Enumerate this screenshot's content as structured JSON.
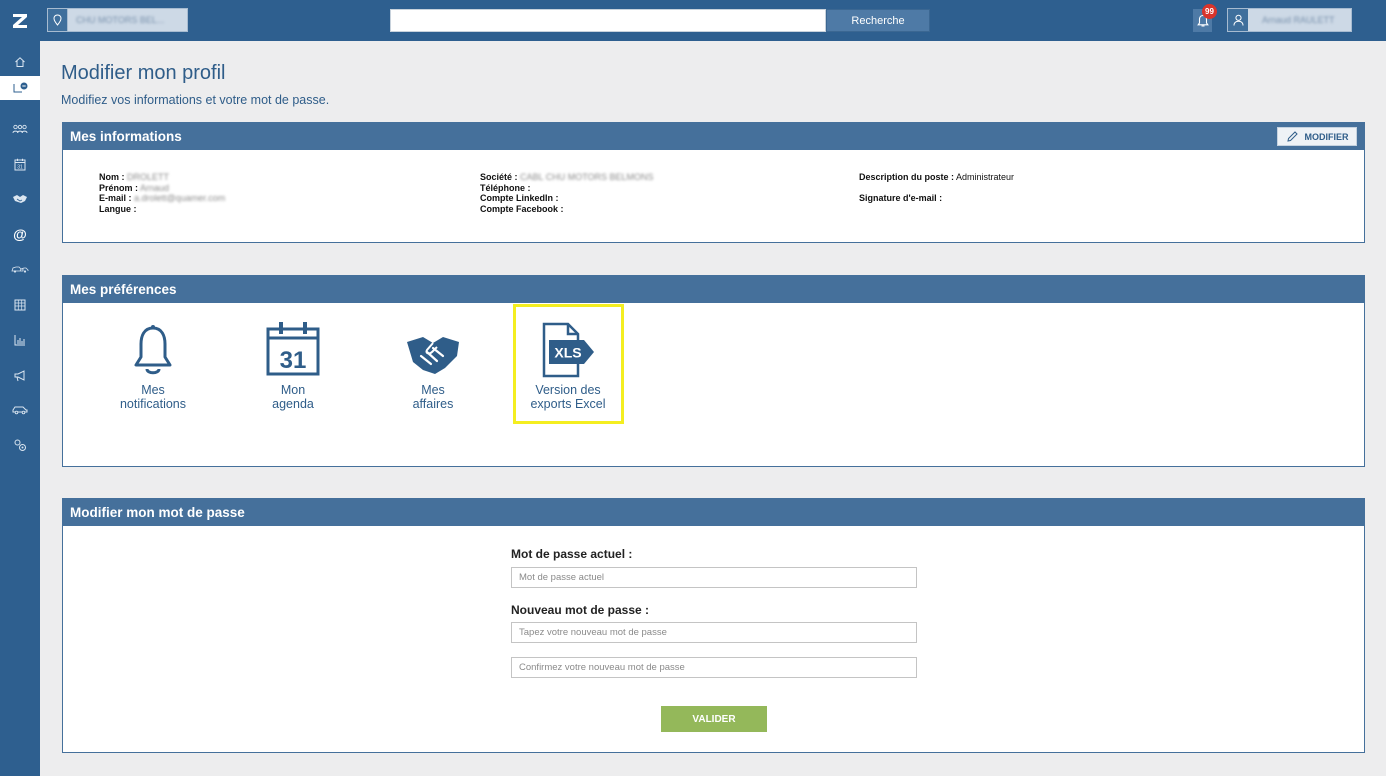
{
  "topbar": {
    "site_text": "CHU MOTORS BEL...",
    "search_button": "Recherche",
    "search_value": "",
    "notification_count": "99",
    "user_name": "Arnaud RAULETT"
  },
  "colors": {
    "brand": "#2e5f8f",
    "header": "#45709b",
    "accent_green": "#94b85a",
    "highlight": "#f4ee20",
    "badge": "#d9342b"
  },
  "sidebar": {
    "items": [
      {
        "icon": "home-icon"
      },
      {
        "icon": "task-list-icon"
      },
      {
        "icon": "contacts-icon"
      },
      {
        "icon": "calendar-icon"
      },
      {
        "icon": "handshake-icon"
      },
      {
        "icon": "at-icon"
      },
      {
        "icon": "vehicles-icon"
      },
      {
        "icon": "table-icon"
      },
      {
        "icon": "stats-icon"
      },
      {
        "icon": "megaphone-icon"
      },
      {
        "icon": "car-icon"
      },
      {
        "icon": "settings-icon"
      }
    ]
  },
  "header": {
    "title": "Modifier mon profil",
    "subtitle": "Modifiez vos informations et votre mot de passe."
  },
  "info": {
    "title": "Mes informations",
    "modify_label": "MODIFIER",
    "col1": [
      {
        "label": "Nom :",
        "value": "DROLETT"
      },
      {
        "label": "Prénom :",
        "value": "Arnaud"
      },
      {
        "label": "E-mail :",
        "value": "a.drolett@quamer.com"
      },
      {
        "label": "Langue :",
        "value": ""
      }
    ],
    "col2": [
      {
        "label": "Société :",
        "value": "CABL CHU MOTORS BELMONS"
      },
      {
        "label": "Téléphone :",
        "value": ""
      },
      {
        "label": "Compte LinkedIn :",
        "value": ""
      },
      {
        "label": "Compte Facebook :",
        "value": ""
      }
    ],
    "col3": [
      {
        "label": "Description du poste :",
        "value": "Administrateur"
      },
      {
        "label": "Signature d'e-mail :",
        "value": ""
      }
    ]
  },
  "preferences": {
    "title": "Mes préférences",
    "items": [
      {
        "line1": "Mes",
        "line2": "notifications",
        "icon": "bell-icon"
      },
      {
        "line1": "Mon",
        "line2": "agenda",
        "icon": "calendar-icon",
        "calendar_day": "31"
      },
      {
        "line1": "Mes",
        "line2": "affaires",
        "icon": "handshake-icon"
      },
      {
        "line1": "Version des",
        "line2": "exports Excel",
        "icon": "xls-file-icon",
        "file_label": "XLS"
      }
    ]
  },
  "password": {
    "title": "Modifier mon mot de passe",
    "current_label": "Mot de passe actuel :",
    "current_placeholder": "Mot de passe actuel",
    "new_label": "Nouveau mot de passe :",
    "new_placeholder": "Tapez votre nouveau mot de passe",
    "confirm_placeholder": "Confirmez votre nouveau mot de passe",
    "submit_label": "VALIDER"
  }
}
